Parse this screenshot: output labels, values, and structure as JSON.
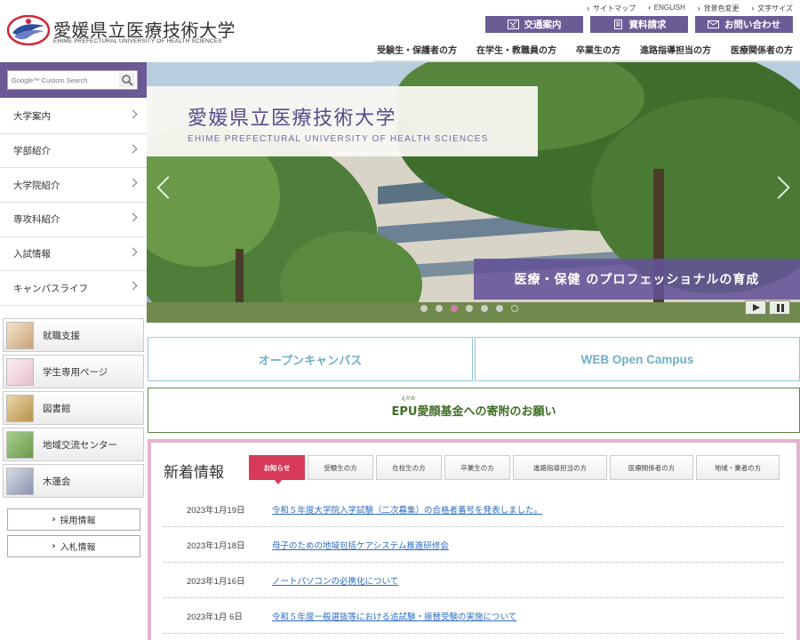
{
  "header": {
    "logo_jp": "愛媛県立医療技術大学",
    "logo_en": "EHIME PREFECTURAL UNIVERSITY OF HEALTH SCIENCES",
    "util_links": [
      "サイトマップ",
      "ENGLISH",
      "背景色変更",
      "文字サイズ"
    ],
    "util_buttons": [
      {
        "label": "交通案内",
        "icon": "map-icon"
      },
      {
        "label": "資料請求",
        "icon": "document-icon"
      },
      {
        "label": "お問い合わせ",
        "icon": "mail-icon"
      }
    ],
    "gnav": [
      "受験生・保護者の方",
      "在学生・教職員の方",
      "卒業生の方",
      "進路指導担当の方",
      "医療関係者の方"
    ],
    "colors": {
      "accent": "#6c5c96",
      "news_border": "#e3b5cc",
      "active_tab": "#d73a58"
    }
  },
  "sidebar": {
    "search": {
      "placeholder": "Google™ Custom Search",
      "icon": "search-icon"
    },
    "menu": [
      "大学案内",
      "学部紹介",
      "大学院紹介",
      "専攻科紹介",
      "入試情報",
      "キャンパスライフ"
    ],
    "banners": [
      "就職支援",
      "学生専用ページ",
      "図書館",
      "地域交流センター",
      "木蓮会"
    ],
    "small_buttons": [
      "採用情報",
      "入札情報"
    ]
  },
  "hero": {
    "title_jp": "愛媛県立医療技術大学",
    "title_en": "EHIME PREFECTURAL UNIVERSITY  OF HEALTH  SCIENCES",
    "caption": "医療・保健 のプロフェッショナルの育成",
    "slide_count": 7,
    "active_slide": 3
  },
  "cta": {
    "open_campus": "オープンキャンパス",
    "web_open_campus": "WEB Open Campus",
    "fund": "EPU愛顔基金への寄附のお願い",
    "fund_ruby": "えがお"
  },
  "news": {
    "title": "新着情報",
    "tabs": [
      "お知らせ",
      "受験生の方",
      "在校生の方",
      "卒業生の方",
      "進路指導担当の方",
      "医療関係者の方",
      "地域・業者の方"
    ],
    "items": [
      {
        "date": "2023年1月19日",
        "text": "令和５年度大学院入学試験（二次募集）の合格者番号を発表しました。"
      },
      {
        "date": "2023年1月18日",
        "text": "母子のための地域包括ケアシステム推進研修会"
      },
      {
        "date": "2023年1月16日",
        "text": "ノートパソコンの必携化について"
      },
      {
        "date": "2023年1月 6日",
        "text": "令和５年度一般選抜等における追試験・振替受験の実施について"
      }
    ]
  }
}
